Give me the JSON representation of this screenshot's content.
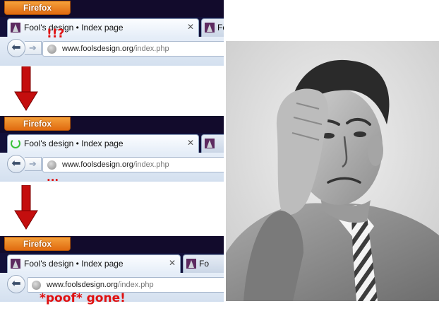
{
  "browser": {
    "menu_label": "Firefox",
    "tab_title": "Fool's design • Index page",
    "second_tab_title": "Fool's design • Index page",
    "second_tab_visible": "Fo",
    "url_domain": "www.foolsdesign.org",
    "url_path": "/index.php"
  },
  "annotations": {
    "first": "!!?",
    "second": "...",
    "third": "*poof* gone!"
  },
  "colors": {
    "annotation_red": "#e01010",
    "arrow_red": "#c40e0e",
    "firefox_orange": "#e9761a",
    "titlebar_dark": "#120b2c"
  },
  "icons": {
    "back": "back-arrow-icon",
    "forward": "forward-arrow-icon",
    "site": "globe-icon",
    "close": "close-icon",
    "loading": "loading-spinner-icon"
  }
}
